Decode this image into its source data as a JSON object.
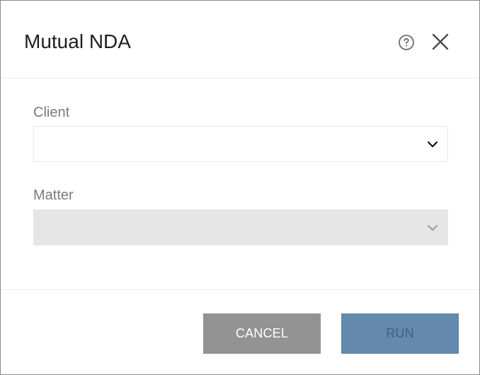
{
  "dialog": {
    "title": "Mutual NDA"
  },
  "icons": {
    "help": "help-circle-icon",
    "close": "close-icon",
    "chevron": "chevron-down-icon"
  },
  "form": {
    "client": {
      "label": "Client",
      "value": ""
    },
    "matter": {
      "label": "Matter",
      "value": "",
      "disabled": true
    }
  },
  "footer": {
    "cancel_label": "CANCEL",
    "run_label": "RUN"
  },
  "colors": {
    "cancel_bg": "#939393",
    "run_bg": "#6589ad",
    "run_text": "#3f5f80",
    "disabled_field_bg": "#e6e6e6"
  }
}
